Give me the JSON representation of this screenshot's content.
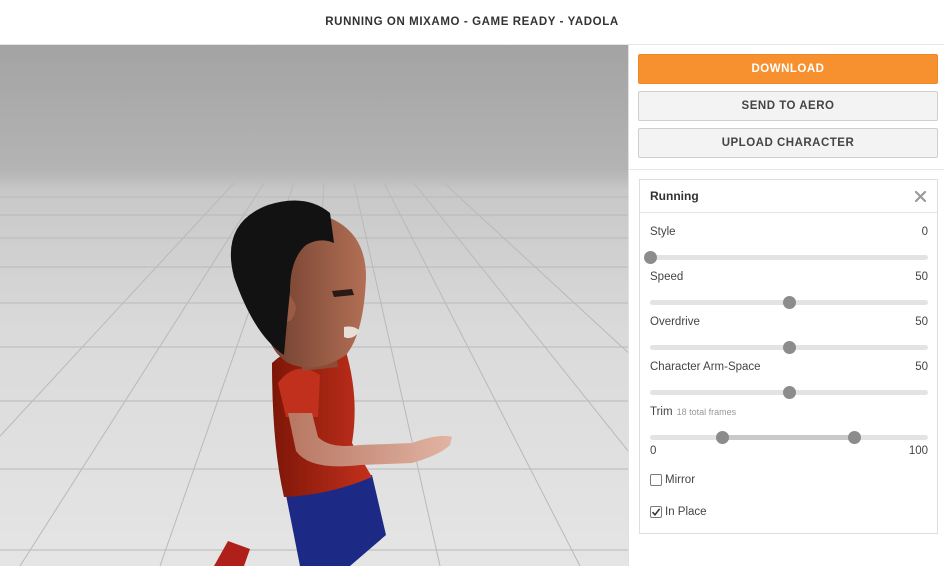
{
  "header": {
    "title": "RUNNING ON MIXAMO - GAME READY - YADOLA"
  },
  "actions": {
    "download_label": "DOWNLOAD",
    "send_label": "SEND TO AERO",
    "upload_label": "UPLOAD CHARACTER"
  },
  "animation_panel": {
    "title": "Running",
    "params": [
      {
        "label": "Style",
        "value": "0",
        "fraction": 0.0
      },
      {
        "label": "Speed",
        "value": "50",
        "fraction": 0.5
      },
      {
        "label": "Overdrive",
        "value": "50",
        "fraction": 0.5
      },
      {
        "label": "Character Arm-Space",
        "value": "50",
        "fraction": 0.5
      }
    ],
    "trim": {
      "label": "Trim",
      "note": "18 total frames",
      "min_label": "0",
      "max_label": "100",
      "start_fraction": 0.26,
      "end_fraction": 0.735
    },
    "mirror": {
      "label": "Mirror",
      "checked": false
    },
    "in_place": {
      "label": "In Place",
      "checked": true
    }
  },
  "colors": {
    "accent": "#f7902f"
  }
}
